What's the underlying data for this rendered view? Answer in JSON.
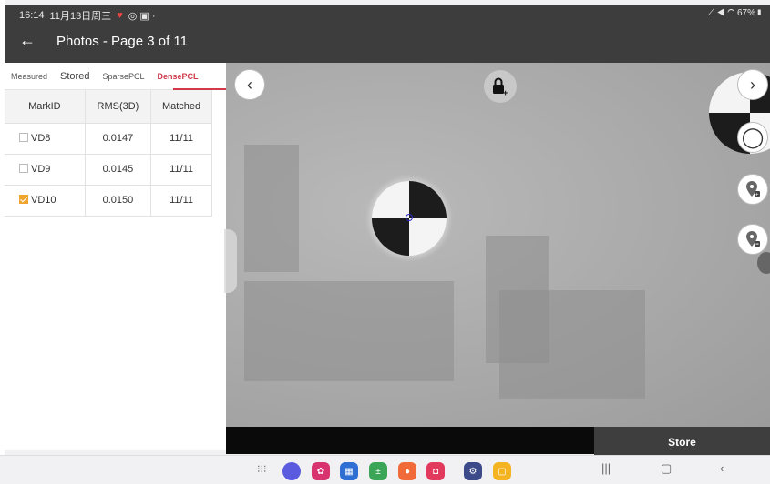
{
  "status_bar": {
    "time": "16:14",
    "date": "11月13日周三",
    "battery": "67%"
  },
  "header": {
    "back_icon": "arrow-left-icon",
    "title": "Photos - Page 3 of 11"
  },
  "tabs": [
    {
      "label": "Measured",
      "active": false
    },
    {
      "label": "Stored",
      "active": false
    },
    {
      "label": "SparsePCL",
      "active": false
    },
    {
      "label": "DensePCL",
      "active": true
    }
  ],
  "table": {
    "columns": [
      "MarkID",
      "RMS(3D)",
      "Matched"
    ],
    "rows": [
      {
        "id": "VD8",
        "rms": "0.0147",
        "matched": "11/11",
        "checked": false
      },
      {
        "id": "VD9",
        "rms": "0.0145",
        "matched": "11/11",
        "checked": false
      },
      {
        "id": "VD10",
        "rms": "0.0150",
        "matched": "11/11",
        "checked": true
      }
    ]
  },
  "viewer": {
    "prev_icon": "chevron-left-icon",
    "next_icon": "chevron-right-icon",
    "lock_icon": "lock-add-icon"
  },
  "actions": {
    "store_label": "Store"
  },
  "colors": {
    "accent": "#d23a4a",
    "checkbox": "#f0a52e",
    "header_bg": "#3d3d3d"
  }
}
